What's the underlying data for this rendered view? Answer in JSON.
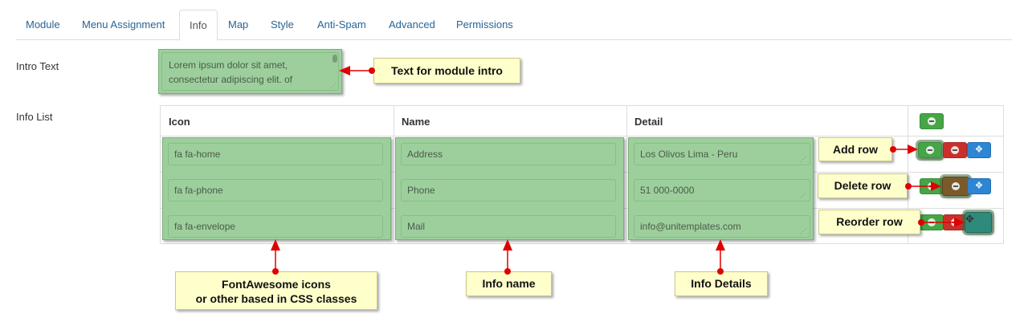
{
  "tabs": [
    {
      "label": "Module"
    },
    {
      "label": "Menu Assignment"
    },
    {
      "label": "Info",
      "active": true
    },
    {
      "label": "Map"
    },
    {
      "label": "Style"
    },
    {
      "label": "Anti-Spam"
    },
    {
      "label": "Advanced"
    },
    {
      "label": "Permissions"
    }
  ],
  "intro": {
    "label": "Intro Text",
    "value": "Lorem ipsum dolor sit amet, consectetur adipiscing elit. of"
  },
  "info_list": {
    "label": "Info List",
    "headers": {
      "icon": "Icon",
      "name": "Name",
      "detail": "Detail"
    },
    "rows": [
      {
        "icon": "fa fa-home",
        "name": "Address",
        "detail": "Los Olivos Lima - Peru"
      },
      {
        "icon": "fa fa-phone",
        "name": "Phone",
        "detail": "51 000-0000"
      },
      {
        "icon": "fa fa-envelope",
        "name": "Mail",
        "detail": "info@unitemplates.com"
      }
    ],
    "buttons": {
      "add_icon": "plus-circle-icon",
      "delete_icon": "minus-circle-icon",
      "move_icon": "move-arrows-icon"
    }
  },
  "callouts": {
    "intro": "Text for module intro",
    "add_row": "Add row",
    "delete_row": "Delete row",
    "reorder_row": "Reorder row",
    "icons_line1": "FontAwesome icons",
    "icons_line2": "or other based in CSS classes",
    "info_name": "Info name",
    "info_details": "Info Details"
  },
  "colors": {
    "highlight_green": "#9dcf9d",
    "callout_yellow": "#ffffcc",
    "arrow_red": "#e00000",
    "tab_link": "#2a6496",
    "btn_green": "#46a546",
    "btn_red": "#c9302c",
    "btn_blue": "#2d86d4"
  }
}
